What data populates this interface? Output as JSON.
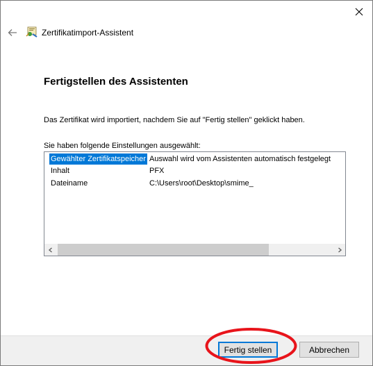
{
  "window": {
    "title": "Zertifikatimport-Assistent"
  },
  "page": {
    "heading": "Fertigstellen des Assistenten",
    "info_text": "Das Zertifikat wird importiert, nachdem Sie auf \"Fertig stellen\" geklickt haben.",
    "settings_label": "Sie haben folgende Einstellungen ausgewählt:"
  },
  "settings": {
    "rows": [
      {
        "name": "Gewählter Zertifikatspeicher",
        "value": "Auswahl wird vom Assistenten automatisch festgelegt",
        "selected": true
      },
      {
        "name": "Inhalt",
        "value": "PFX",
        "selected": false
      },
      {
        "name": "Dateiname",
        "value": "C:\\Users\\root\\Desktop\\smime_",
        "selected": false
      }
    ]
  },
  "buttons": {
    "finish_label": "Fertig stellen",
    "cancel_label": "Abbrechen"
  },
  "colors": {
    "selection": "#0078d7",
    "highlight_ellipse": "#e8141b",
    "footer_bg": "#f0f0f0"
  },
  "icons": {
    "close": "close-icon",
    "back": "back-arrow-icon",
    "app": "certificate-wizard-icon",
    "scroll_left": "chevron-left-icon",
    "scroll_right": "chevron-right-icon"
  }
}
